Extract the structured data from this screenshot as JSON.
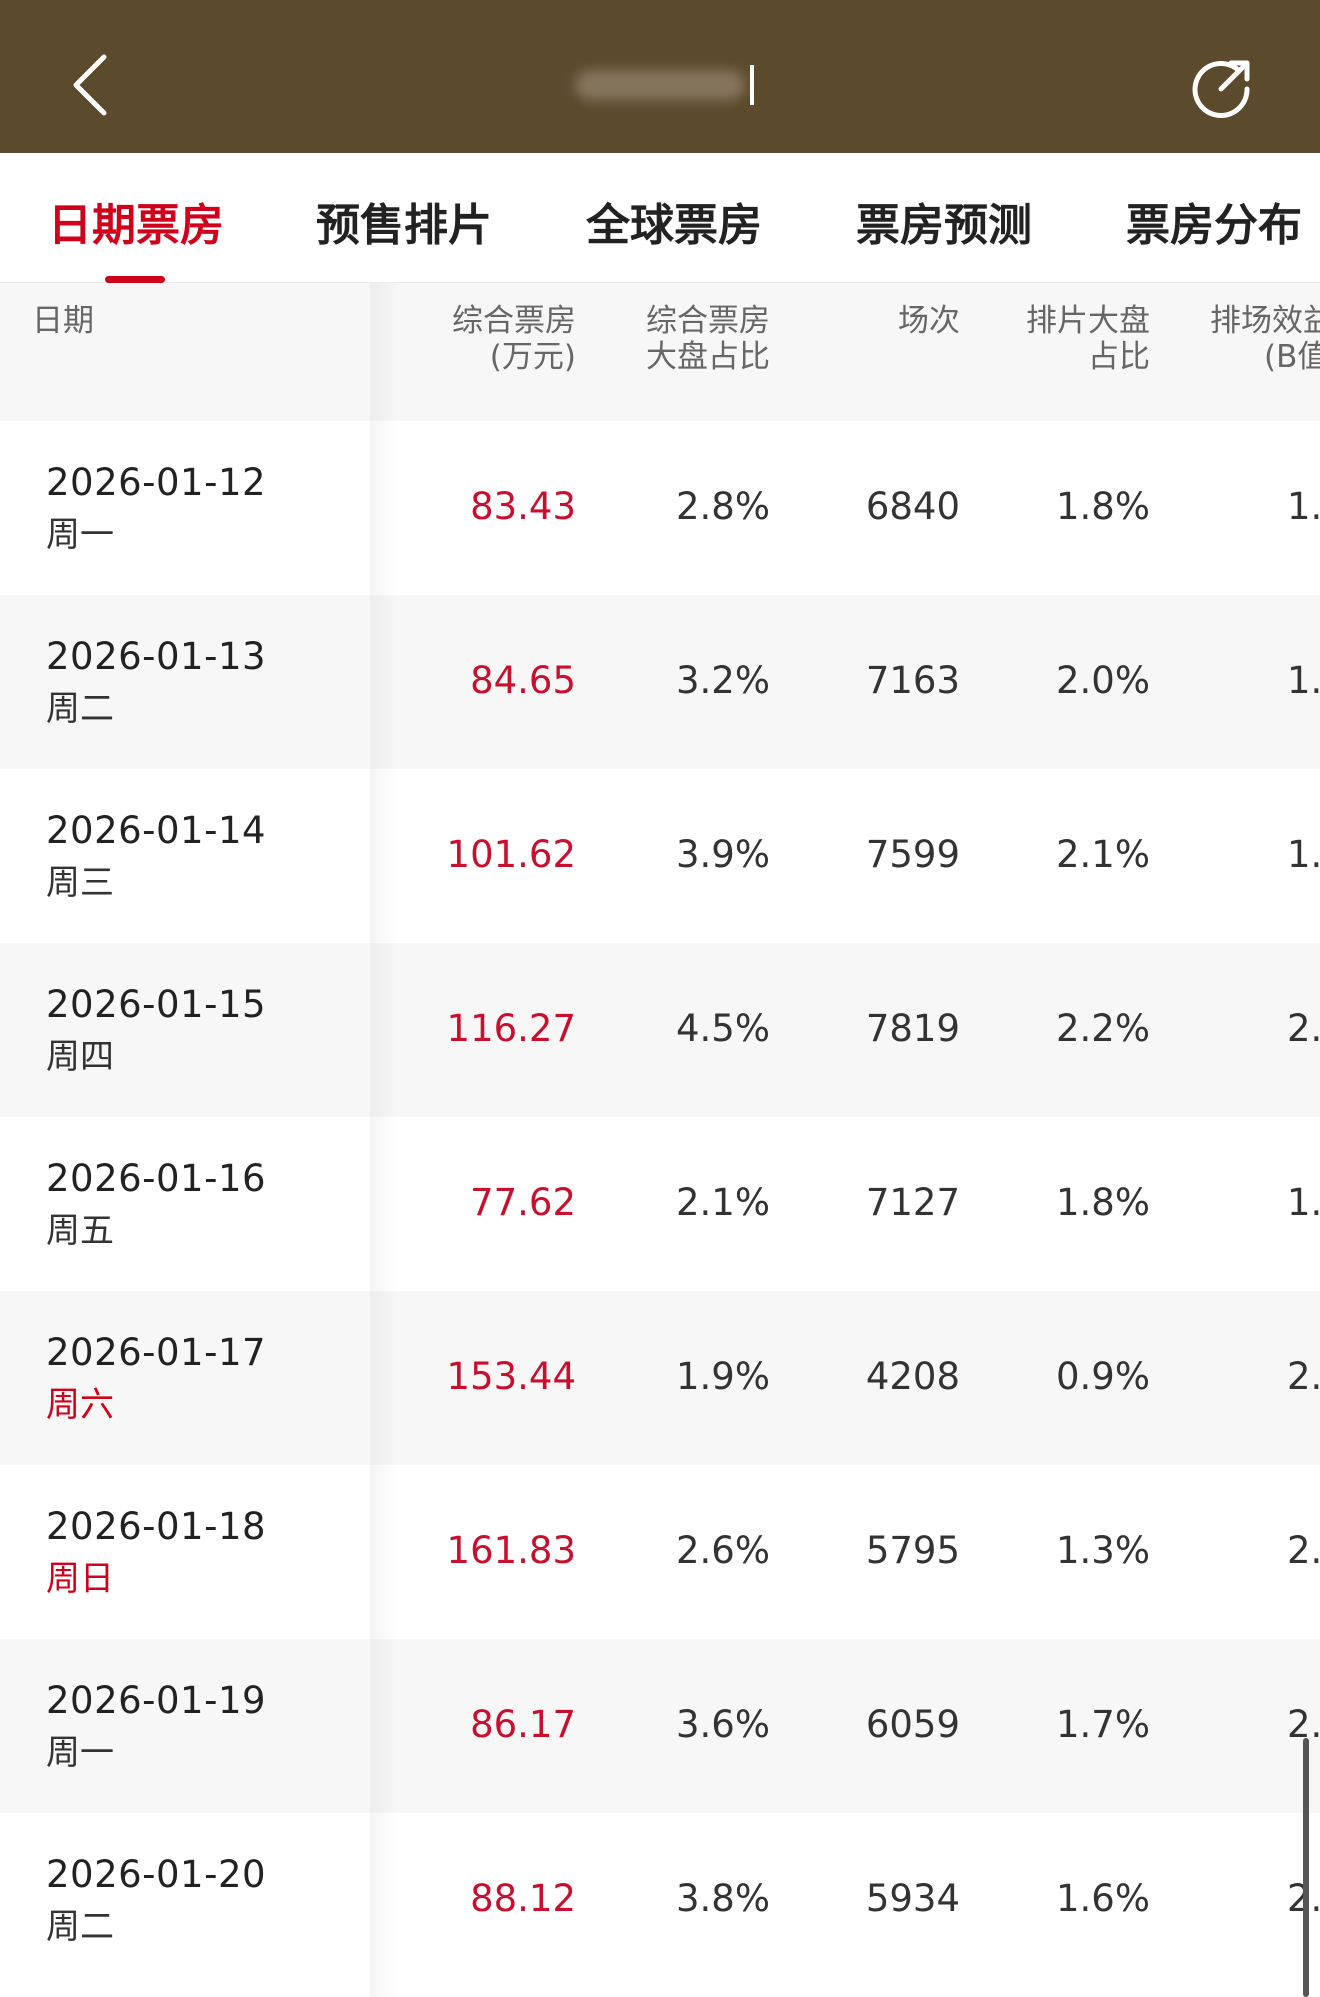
{
  "header": {
    "background": "#5c4a2c",
    "title": "",
    "back_icon": "chevron-left-icon",
    "share_icon": "share-icon"
  },
  "tabs": [
    {
      "label": "日期票房",
      "active": true
    },
    {
      "label": "预售排片",
      "active": false
    },
    {
      "label": "全球票房",
      "active": false
    },
    {
      "label": "票房预测",
      "active": false
    },
    {
      "label": "票房分布",
      "active": false
    }
  ],
  "accent_color": "#d0021b",
  "table": {
    "headers": {
      "date": "日期",
      "box_office_l1": "综合票房",
      "box_office_l2": "(万元)",
      "share_l1": "综合票房",
      "share_l2": "大盘占比",
      "shows": "场次",
      "schedule_l1": "排片大盘",
      "schedule_l2": "占比",
      "efficiency_l1": "排场效益",
      "efficiency_l2": "(B值"
    },
    "rows": [
      {
        "date": "2026-01-12",
        "weekday": "周一",
        "weekend": false,
        "box_office": "83.43",
        "share": "2.8%",
        "shows": "6840",
        "schedule": "1.8%",
        "efficiency": "1."
      },
      {
        "date": "2026-01-13",
        "weekday": "周二",
        "weekend": false,
        "box_office": "84.65",
        "share": "3.2%",
        "shows": "7163",
        "schedule": "2.0%",
        "efficiency": "1."
      },
      {
        "date": "2026-01-14",
        "weekday": "周三",
        "weekend": false,
        "box_office": "101.62",
        "share": "3.9%",
        "shows": "7599",
        "schedule": "2.1%",
        "efficiency": "1."
      },
      {
        "date": "2026-01-15",
        "weekday": "周四",
        "weekend": false,
        "box_office": "116.27",
        "share": "4.5%",
        "shows": "7819",
        "schedule": "2.2%",
        "efficiency": "2."
      },
      {
        "date": "2026-01-16",
        "weekday": "周五",
        "weekend": false,
        "box_office": "77.62",
        "share": "2.1%",
        "shows": "7127",
        "schedule": "1.8%",
        "efficiency": "1."
      },
      {
        "date": "2026-01-17",
        "weekday": "周六",
        "weekend": true,
        "box_office": "153.44",
        "share": "1.9%",
        "shows": "4208",
        "schedule": "0.9%",
        "efficiency": "2."
      },
      {
        "date": "2026-01-18",
        "weekday": "周日",
        "weekend": true,
        "box_office": "161.83",
        "share": "2.6%",
        "shows": "5795",
        "schedule": "1.3%",
        "efficiency": "2."
      },
      {
        "date": "2026-01-19",
        "weekday": "周一",
        "weekend": false,
        "box_office": "86.17",
        "share": "3.6%",
        "shows": "6059",
        "schedule": "1.7%",
        "efficiency": "2."
      },
      {
        "date": "2026-01-20",
        "weekday": "周二",
        "weekend": false,
        "box_office": "88.12",
        "share": "3.8%",
        "shows": "5934",
        "schedule": "1.6%",
        "efficiency": "2."
      }
    ]
  }
}
